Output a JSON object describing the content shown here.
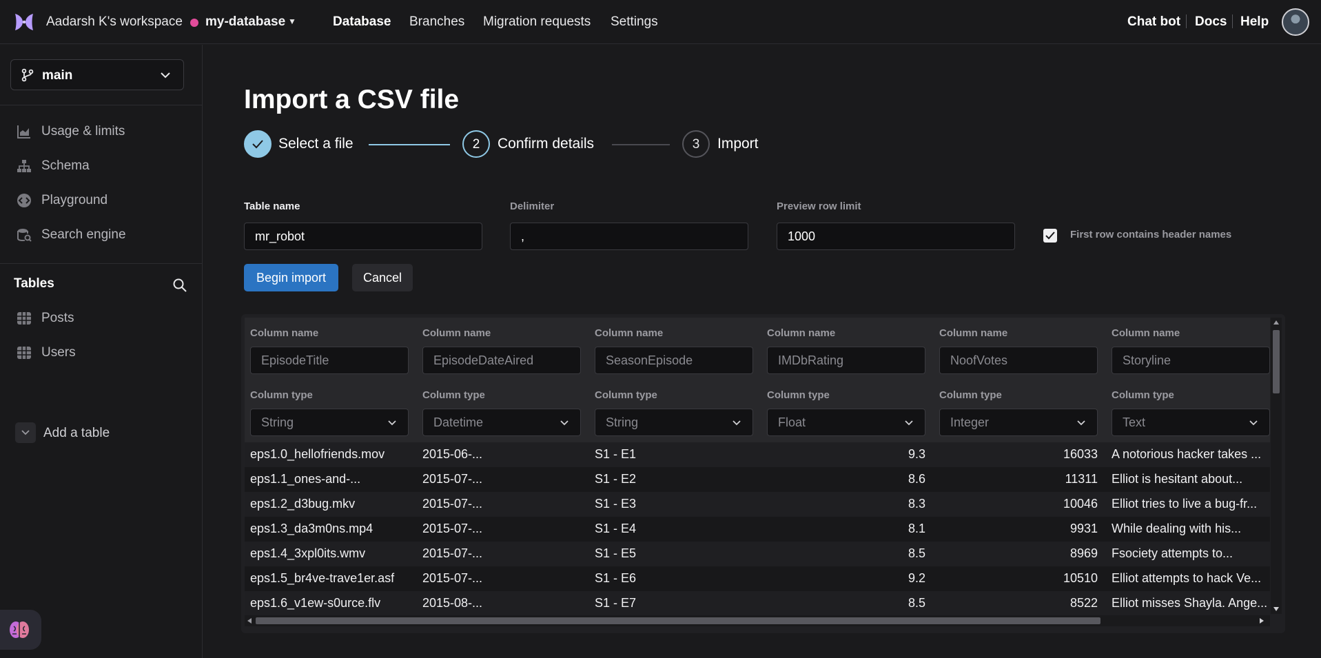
{
  "topbar": {
    "workspace": "Aadarsh K's workspace",
    "database": "my-database",
    "nav": [
      "Database",
      "Branches",
      "Migration requests",
      "Settings"
    ],
    "active_nav": "Database",
    "right_links": [
      "Chat bot",
      "Docs",
      "Help"
    ]
  },
  "sidebar": {
    "branch": "main",
    "items": [
      {
        "label": "Usage & limits",
        "icon": "chart-icon"
      },
      {
        "label": "Schema",
        "icon": "schema-icon"
      },
      {
        "label": "Playground",
        "icon": "playground-icon"
      },
      {
        "label": "Search engine",
        "icon": "search-engine-icon"
      }
    ],
    "tables_title": "Tables",
    "tables": [
      "Posts",
      "Users"
    ],
    "add_table": "Add a table"
  },
  "page": {
    "title": "Import a CSV file",
    "steps": [
      {
        "number": "✓",
        "label": "Select a file",
        "state": "done"
      },
      {
        "number": "2",
        "label": "Confirm details",
        "state": "active"
      },
      {
        "number": "3",
        "label": "Import",
        "state": "pending"
      }
    ],
    "fields": {
      "table_name_label": "Table name",
      "table_name": "mr_robot",
      "delimiter_label": "Delimiter",
      "delimiter": ",",
      "preview_limit_label": "Preview row limit",
      "preview_limit": "1000",
      "header_checkbox_label": "First row contains header names",
      "header_checkbox_checked": true
    },
    "buttons": {
      "begin": "Begin import",
      "cancel": "Cancel"
    }
  },
  "preview": {
    "column_name_label": "Column name",
    "column_type_label": "Column type",
    "columns": [
      {
        "name": "EpisodeTitle",
        "type": "String",
        "align": "left"
      },
      {
        "name": "EpisodeDateAired",
        "type": "Datetime",
        "align": "left"
      },
      {
        "name": "SeasonEpisode",
        "type": "String",
        "align": "left"
      },
      {
        "name": "IMDbRating",
        "type": "Float",
        "align": "right"
      },
      {
        "name": "NoofVotes",
        "type": "Integer",
        "align": "right"
      },
      {
        "name": "Storyline",
        "type": "Text",
        "align": "left"
      }
    ],
    "rows": [
      [
        "eps1.0_hellofriends.mov",
        "2015-06-...",
        "S1 - E1",
        "9.3",
        "16033",
        "A notorious hacker takes ..."
      ],
      [
        "eps1.1_ones-and-...",
        "2015-07-...",
        "S1 - E2",
        "8.6",
        "11311",
        "Elliot is hesitant about..."
      ],
      [
        "eps1.2_d3bug.mkv",
        "2015-07-...",
        "S1 - E3",
        "8.3",
        "10046",
        "Elliot tries to live a bug-fr..."
      ],
      [
        "eps1.3_da3m0ns.mp4",
        "2015-07-...",
        "S1 - E4",
        "8.1",
        "9931",
        "While dealing with his..."
      ],
      [
        "eps1.4_3xpl0its.wmv",
        "2015-07-...",
        "S1 - E5",
        "8.5",
        "8969",
        "Fsociety attempts to..."
      ],
      [
        "eps1.5_br4ve-trave1er.asf",
        "2015-07-...",
        "S1 - E6",
        "9.2",
        "10510",
        "Elliot attempts to hack Ve..."
      ],
      [
        "eps1.6_v1ew-s0urce.flv",
        "2015-08-...",
        "S1 - E7",
        "8.5",
        "8522",
        "Elliot misses Shayla. Ange..."
      ]
    ]
  },
  "colors": {
    "accent": "#2b74c2",
    "step_done": "#8fc9e6",
    "db_dot": "#e24c9b"
  }
}
